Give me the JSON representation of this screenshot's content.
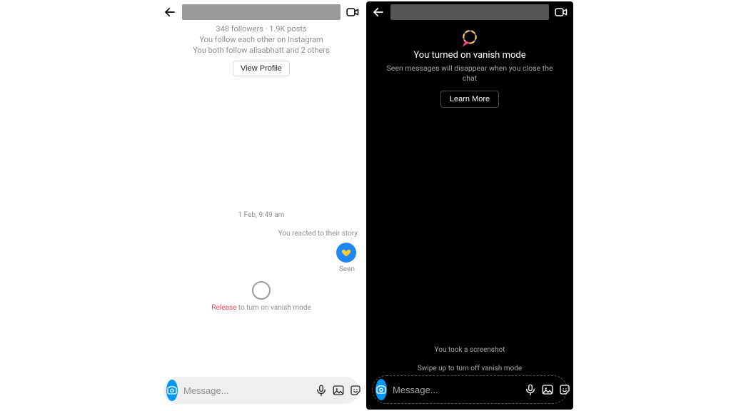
{
  "left": {
    "profile": {
      "stats": "348 followers · 1.9K posts",
      "line2": "You follow each other on Instagram",
      "line3": "You both follow aliaabhatt and 2 others",
      "view_profile": "View Profile"
    },
    "timestamp": "1 Feb, 9:49 am",
    "reacted": "You reacted to their story",
    "seen": "Seen",
    "release_prefix": "Release",
    "release_rest": " to turn on vanish mode",
    "composer_placeholder": "Message..."
  },
  "right": {
    "vanish_title": "You turned on vanish mode",
    "vanish_sub": "Seen messages will disappear when you close the chat",
    "learn_more": "Learn More",
    "screenshot": "You took a screenshot",
    "swipe": "Swipe up to turn off vanish mode",
    "composer_placeholder": "Message..."
  }
}
